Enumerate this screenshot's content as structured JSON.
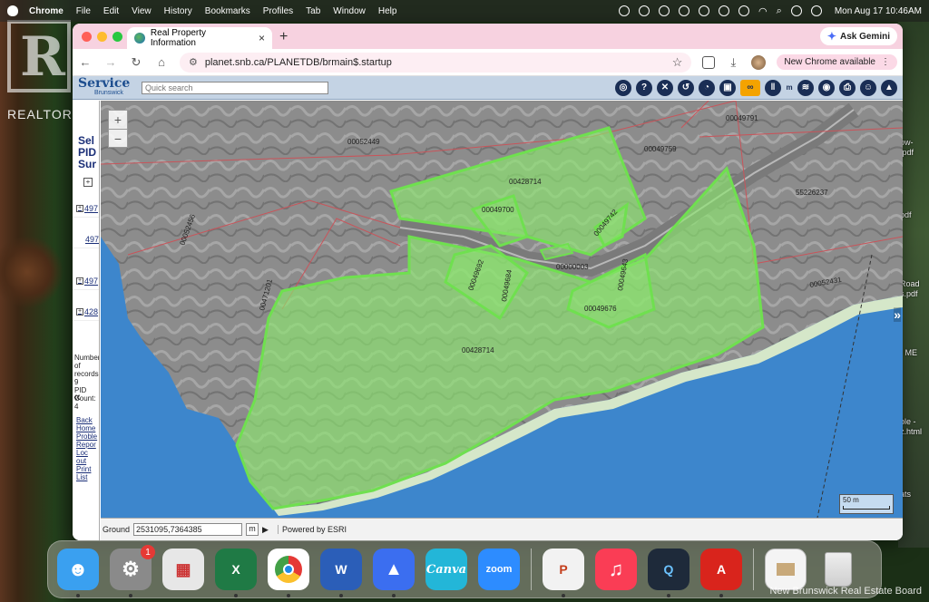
{
  "menubar": {
    "app_name": "Chrome",
    "menus": [
      "File",
      "Edit",
      "View",
      "History",
      "Bookmarks",
      "Profiles",
      "Tab",
      "Window",
      "Help"
    ],
    "clock": "Mon Aug 17  10:46AM"
  },
  "desktop": {
    "watermark": "REALTOR®",
    "files": [
      "ow-\n.pdf",
      "pdf",
      "Road\ns.pdf",
      "r ME",
      "ble -\nz.html",
      "ats"
    ]
  },
  "browser": {
    "tab_title": "Real Property Information",
    "url": "planet.snb.ca/PLANETDB/brmain$.startup",
    "ask_gemini": "Ask Gemini",
    "new_chrome_available": "New Chrome available"
  },
  "page": {
    "logo_main": "Service",
    "logo_sub": "Brunswick",
    "quick_search_placeholder": "Quick search",
    "sidebar": {
      "title": "Sel\nPID\nSur",
      "pids": [
        "497",
        "497",
        "497",
        "428"
      ],
      "stats": "Number\nof\nrecords:\n9\nPID\nCount:\n4",
      "links": [
        "Back",
        "Home",
        "Proble",
        "Repor",
        "Loc",
        "out",
        "Print",
        "List"
      ]
    },
    "map": {
      "labels": {
        "p1": "00052449",
        "p2": "00049791",
        "p3": "00049759",
        "p4": "00428714",
        "p5": "00049700",
        "p6": "00049742",
        "p7": "55226237",
        "p8": "00052456",
        "p9": "00049692",
        "p10": "00049684",
        "p11": "00000003",
        "p12": "00049643",
        "p13": "00052431",
        "p14": "00471201",
        "p15": "00049676",
        "p16": "00428714"
      },
      "scale_label": "50 m"
    },
    "statusbar": {
      "ground_label": "Ground",
      "coordinates": "2531095,7364385",
      "unit": "m",
      "powered_by": "Powered by ESRI"
    }
  },
  "dock": {
    "apps": [
      {
        "name": "Finder",
        "label": "",
        "color": "#3aa0f0"
      },
      {
        "name": "System Settings",
        "label": "",
        "color": "#8a8a8a",
        "badge": "1"
      },
      {
        "name": "Launchpad",
        "label": "",
        "color": "#e7e7e7"
      },
      {
        "name": "Excel",
        "label": "X",
        "color": "#1f7a45"
      },
      {
        "name": "Chrome",
        "label": "",
        "color": "#ffffff"
      },
      {
        "name": "Word",
        "label": "W",
        "color": "#2b5eb8"
      },
      {
        "name": "NordVPN",
        "label": "",
        "color": "#3b6ef0"
      },
      {
        "name": "Canva",
        "label": "Canva",
        "color": "#23b6d8"
      },
      {
        "name": "Zoom",
        "label": "zoom",
        "color": "#2d8cff"
      },
      {
        "name": "PowerPoint",
        "label": "P",
        "color": "#f2f2f2"
      },
      {
        "name": "Music",
        "label": "♫",
        "color": "#fa3d55"
      },
      {
        "name": "QuickTime",
        "label": "Q",
        "color": "#1e2a3a"
      },
      {
        "name": "Acrobat",
        "label": "A",
        "color": "#d9241c"
      }
    ],
    "caption": "New Brunswick Real Estate Board"
  }
}
